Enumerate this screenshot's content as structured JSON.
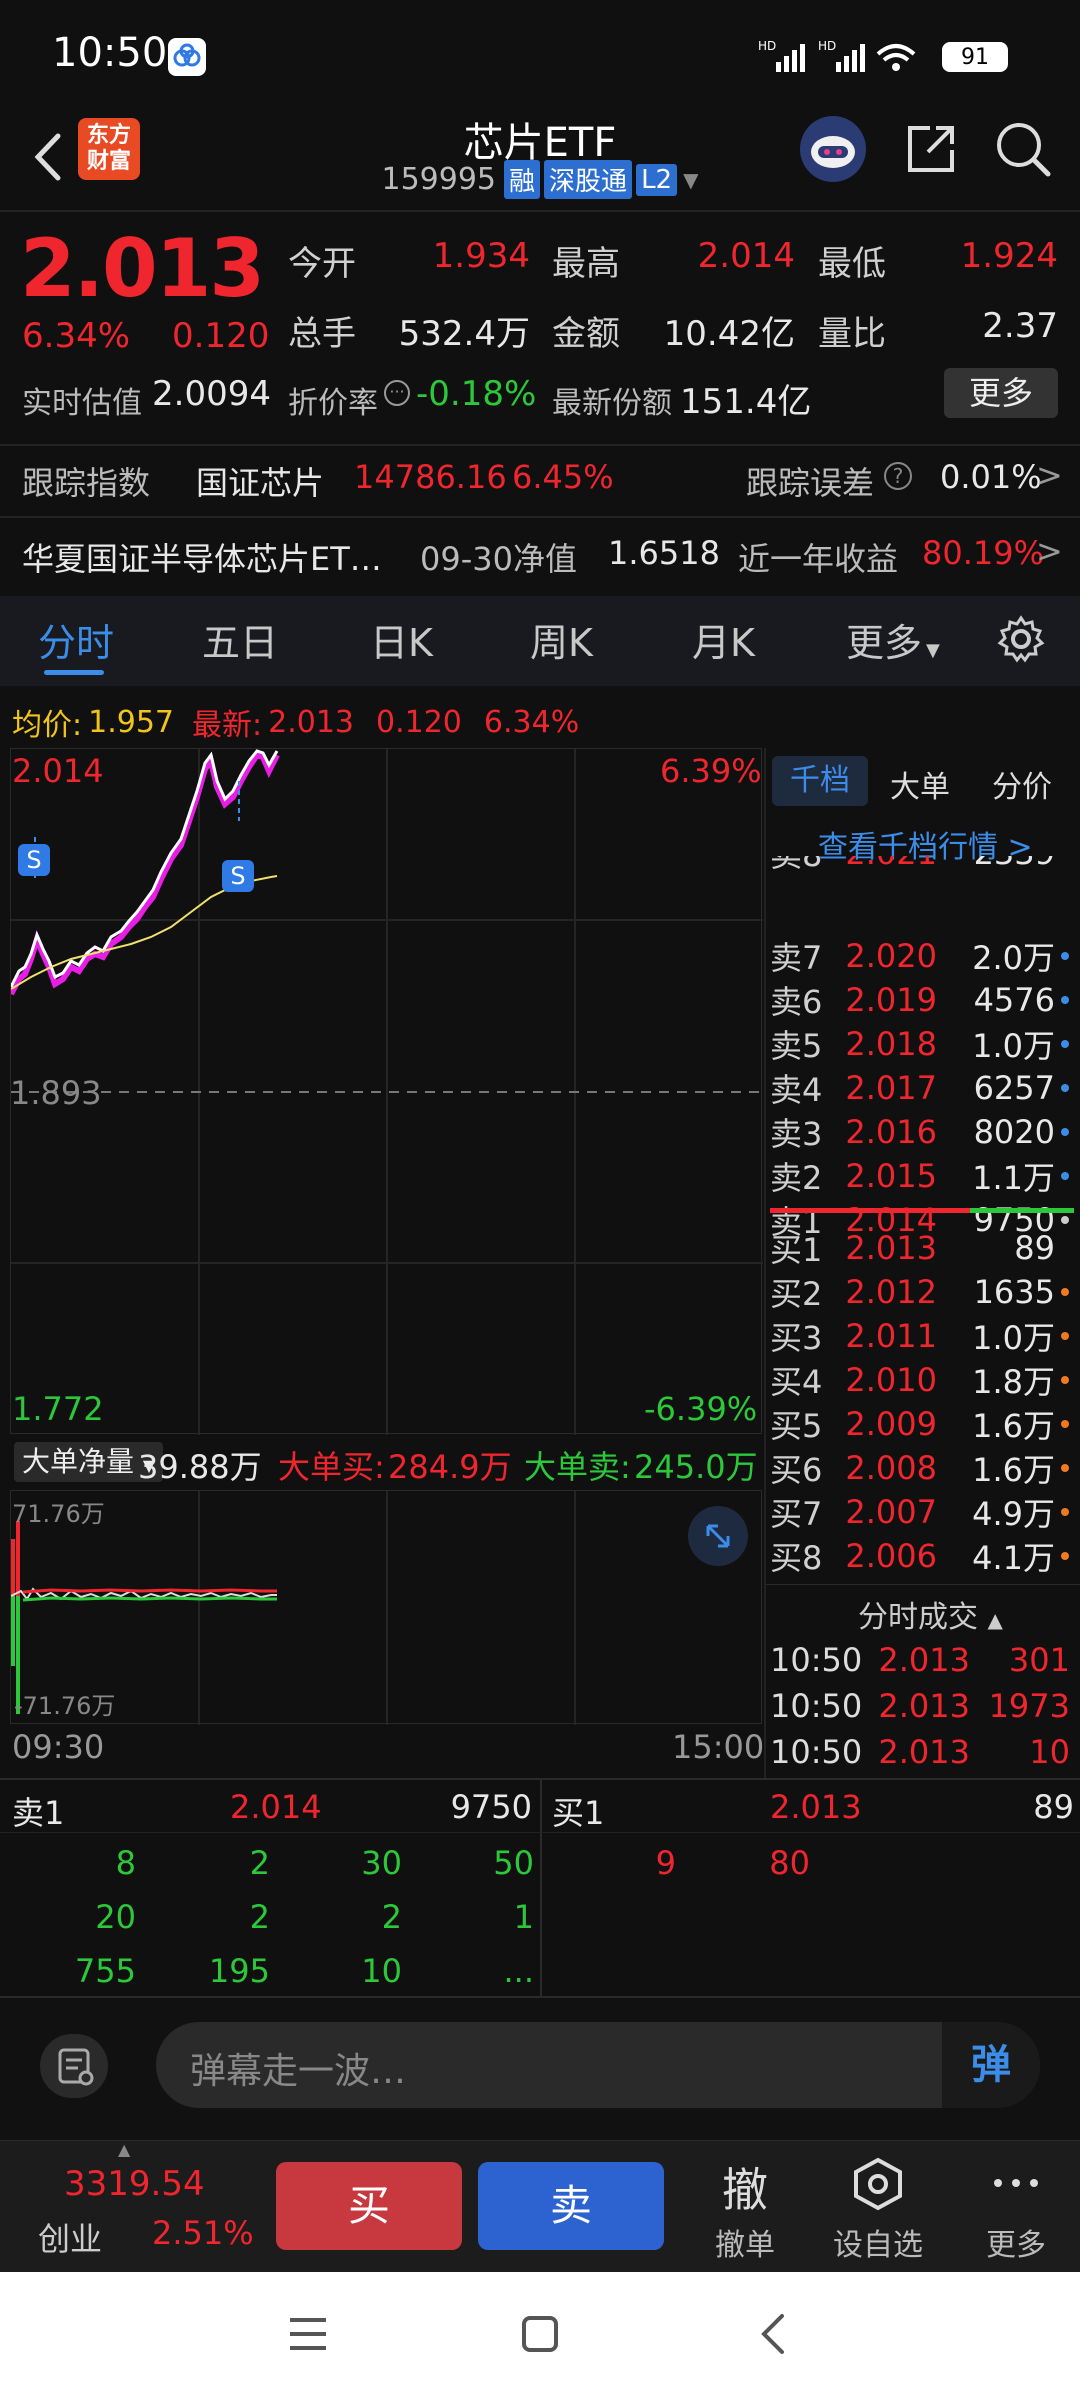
{
  "status": {
    "time": "10:50",
    "battery": "91"
  },
  "header": {
    "title": "芯片ETF",
    "code": "159995",
    "tags": [
      "融",
      "深股通",
      "L2"
    ],
    "logo_text_1": "东方",
    "logo_text_2": "财富"
  },
  "quote": {
    "price": "2.013",
    "change_pct": "6.34%",
    "change": "0.120",
    "open_label": "今开",
    "open": "1.934",
    "high_label": "最高",
    "high": "2.014",
    "low_label": "最低",
    "low": "1.924",
    "volume_label": "总手",
    "volume": "532.4万",
    "amount_label": "金额",
    "amount": "10.42亿",
    "ratio_label": "量比",
    "ratio": "2.37",
    "est_label": "实时估值",
    "est": "2.0094",
    "premium_label": "折价率",
    "premium": "-0.18%",
    "shares_label": "最新份额",
    "shares": "151.4亿",
    "more_button": "更多"
  },
  "tracking": {
    "label": "跟踪指数",
    "index_name": "国证芯片",
    "index_value": "14786.16",
    "index_pct": "6.45%",
    "error_label": "跟踪误差",
    "error_value": "0.01%"
  },
  "fund": {
    "name": "华夏国证半导体芯片ET…",
    "nav_label": "09-30净值",
    "nav": "1.6518",
    "return_label": "近一年收益",
    "return": "80.19%"
  },
  "tabs": [
    "分时",
    "五日",
    "日K",
    "周K",
    "月K",
    "更多"
  ],
  "chart_header": {
    "avg_label": "均价:",
    "avg": "1.957",
    "latest_label": "最新:",
    "latest": "2.013",
    "latest_change": "0.120",
    "latest_pct": "6.34%"
  },
  "chart": {
    "top_price": "2.014",
    "top_pct": "6.39%",
    "mid_price": "1.893",
    "bottom_price": "1.772",
    "bottom_pct": "-6.39%",
    "marker": "S",
    "time_start": "09:30",
    "time_end": "15:00"
  },
  "flow": {
    "dropdown": "大单净量",
    "net": "39.88万",
    "buy_label": "大单买:",
    "buy": "284.9万",
    "sell_label": "大单卖:",
    "sell": "245.0万",
    "top_value": "71.76万",
    "bottom_value": "-71.76万"
  },
  "orderbook": {
    "tabs": [
      "千档",
      "大单",
      "分价"
    ],
    "link": "查看千档行情 >",
    "partial": {
      "label": "卖8",
      "price": "2.021",
      "vol": "2339"
    },
    "asks": [
      {
        "label": "卖7",
        "price": "2.020",
        "vol": "2.0万"
      },
      {
        "label": "卖6",
        "price": "2.019",
        "vol": "4576"
      },
      {
        "label": "卖5",
        "price": "2.018",
        "vol": "1.0万"
      },
      {
        "label": "卖4",
        "price": "2.017",
        "vol": "6257"
      },
      {
        "label": "卖3",
        "price": "2.016",
        "vol": "8020"
      },
      {
        "label": "卖2",
        "price": "2.015",
        "vol": "1.1万"
      },
      {
        "label": "卖1",
        "price": "2.014",
        "vol": "9750"
      }
    ],
    "bids": [
      {
        "label": "买1",
        "price": "2.013",
        "vol": "89"
      },
      {
        "label": "买2",
        "price": "2.012",
        "vol": "1635"
      },
      {
        "label": "买3",
        "price": "2.011",
        "vol": "1.0万"
      },
      {
        "label": "买4",
        "price": "2.010",
        "vol": "1.8万"
      },
      {
        "label": "买5",
        "price": "2.009",
        "vol": "1.6万"
      },
      {
        "label": "买6",
        "price": "2.008",
        "vol": "1.6万"
      },
      {
        "label": "买7",
        "price": "2.007",
        "vol": "4.9万"
      },
      {
        "label": "买8",
        "price": "2.006",
        "vol": "4.1万"
      }
    ],
    "trades_label": "分时成交",
    "trades": [
      {
        "time": "10:50",
        "price": "2.013",
        "vol": "301"
      },
      {
        "time": "10:50",
        "price": "2.013",
        "vol": "1973"
      },
      {
        "time": "10:50",
        "price": "2.013",
        "vol": "10"
      }
    ]
  },
  "queue": {
    "sell_label": "卖1",
    "sell_price": "2.014",
    "sell_vol": "9750",
    "buy_label": "买1",
    "buy_price": "2.013",
    "buy_vol": "89",
    "sell_cells": [
      "8",
      "2",
      "30",
      "50",
      "20",
      "2",
      "2",
      "1",
      "755",
      "195",
      "10",
      "..."
    ],
    "buy_cells": [
      "9",
      "80"
    ]
  },
  "danmaku": {
    "placeholder": "弹幕走一波…",
    "button": "弹"
  },
  "bottom": {
    "index_value": "3319.54",
    "index_name": "创业",
    "index_pct": "2.51%",
    "buy": "买",
    "sell": "卖",
    "cancel_icon": "撤",
    "cancel": "撤单",
    "watch": "设自选",
    "more": "更多"
  }
}
